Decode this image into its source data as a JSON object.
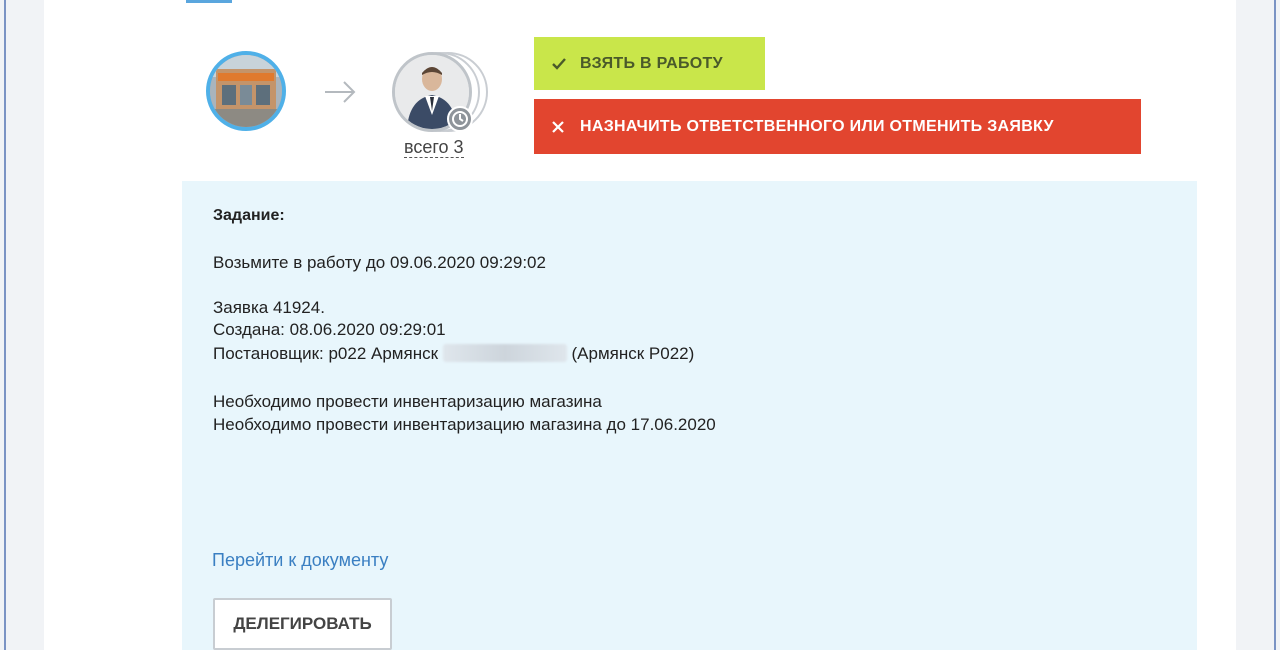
{
  "actions": {
    "take_label": "ВЗЯТЬ В РАБОТУ",
    "take_color": "#c9e64a",
    "cancel_label": "НАЗНАЧИТЬ ОТВЕТСТВЕННОГО ИЛИ ОТМЕНИТЬ ЗАЯВКУ",
    "cancel_color": "#e2452f"
  },
  "workflow": {
    "total_label": "всего 3",
    "from_icon": "store-photo",
    "to_icon": "person-avatar",
    "badge_icon": "clock-icon"
  },
  "task": {
    "heading": "Задание:",
    "deadline": "Возьмите в работу до 09.06.2020 09:29:02",
    "request": "Заявка 41924.",
    "created": "Создана: 08.06.2020 09:29:01",
    "author_prefix": "Постановщик: р022 Армянск",
    "author_suffix": "(Армянск Р022)",
    "description_1": "Необходимо провести инвентаризацию магазина",
    "description_2": "Необходимо провести инвентаризацию магазина до 17.06.2020",
    "doc_link": "Перейти к документу",
    "delegate_label": "ДЕЛЕГИРОВАТЬ"
  }
}
